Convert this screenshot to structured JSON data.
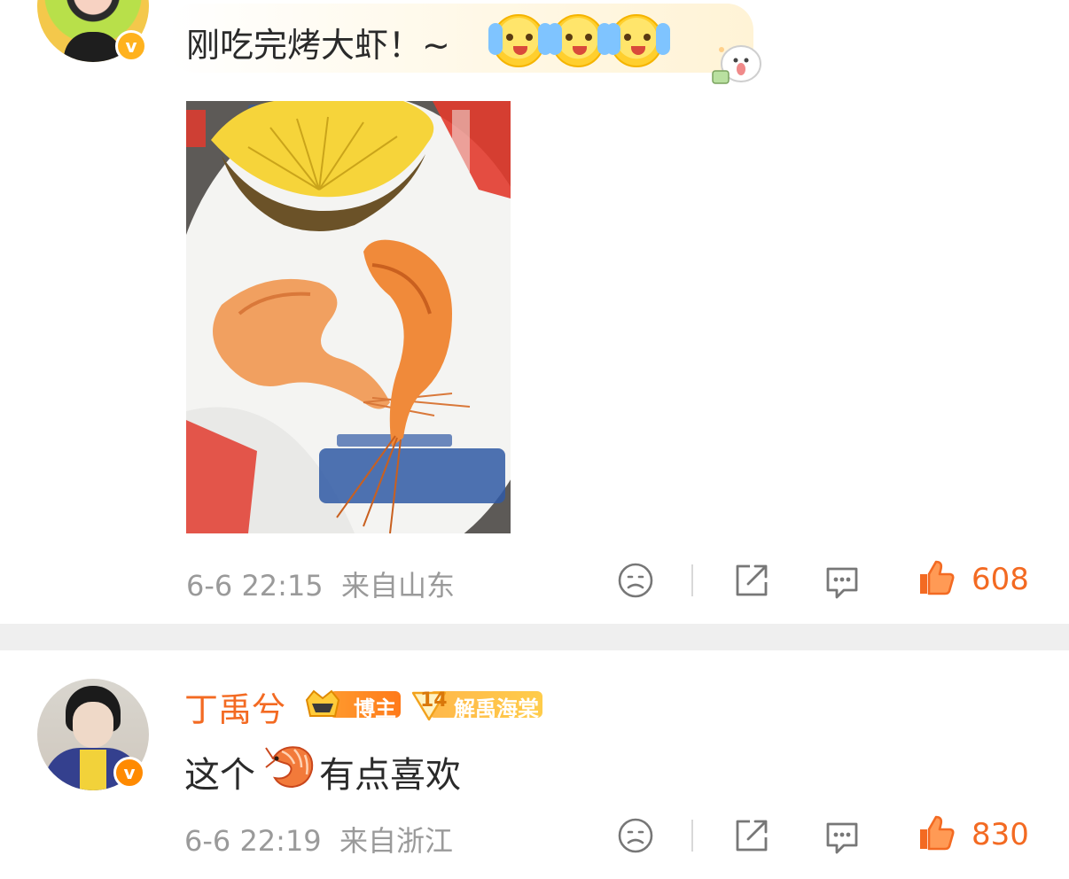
{
  "comments": [
    {
      "text": "刚吃完烤大虾！~",
      "emojis": [
        "yay-emoji",
        "yay-emoji",
        "yay-emoji"
      ],
      "time": "6-6 22:15",
      "location": "来自山东",
      "likes": "608",
      "photo": "grilled-shrimp-and-pineapple-on-plate"
    },
    {
      "username": "丁禹兮",
      "badge_blogger": "博主",
      "badge_fan_level": "14",
      "badge_fan_name": "解禹海棠",
      "text_before": "这个",
      "inline_emoji": "shrimp-emoji",
      "text_after": "有点喜欢",
      "time": "6-6 22:19",
      "location": "来自浙江",
      "likes": "830"
    }
  ],
  "colors": {
    "accent_orange": "#f36a22",
    "meta_gray": "#9a9a9a",
    "verified_badge": "#ffb21e",
    "divider": "#efefef"
  }
}
